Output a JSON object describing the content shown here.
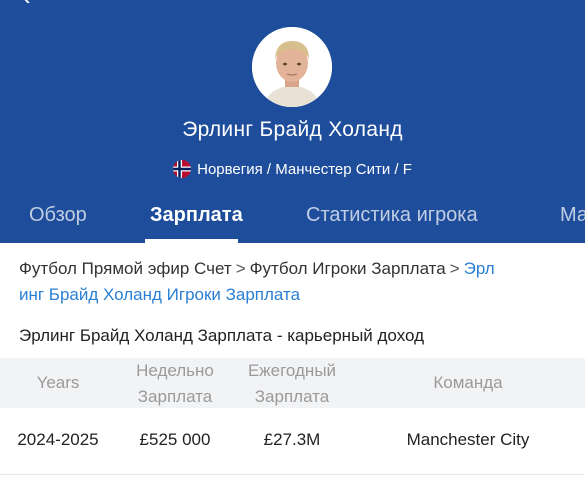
{
  "player": {
    "name": "Эрлинг Брайд Холанд",
    "info": "Норвегия / Манчестер Сити / F"
  },
  "tabs": [
    {
      "label": "Обзор"
    },
    {
      "label": "Зарплата"
    },
    {
      "label": "Статистика игрока"
    },
    {
      "label": "Ма"
    }
  ],
  "breadcrumb": {
    "item1": "Футбол Прямой эфир Счет",
    "item2": "Футбол Игроки Зарплата",
    "item3_line1": "Эрл",
    "item3_line2": "инг Брайд Холанд Игроки Зарплата",
    "separator": ">"
  },
  "section_title": "Эрлинг Брайд Холанд Зарплата - карьерный доход",
  "table": {
    "headers": {
      "years": "Years",
      "weekly_line1": "Недельно",
      "weekly_line2": "Зарплата",
      "yearly_line1": "Ежегодный",
      "yearly_line2": "Зарплата",
      "team": "Команда"
    },
    "rows": [
      {
        "years": "2024-2025",
        "weekly": "£525 000",
        "yearly": "£27.3M",
        "team": "Manchester City"
      }
    ]
  },
  "colors": {
    "header_bg": "#1e4d9b",
    "link": "#2a7fd4"
  },
  "icons": {
    "back": "back-arrow-icon",
    "flag": "norway-flag-icon"
  }
}
